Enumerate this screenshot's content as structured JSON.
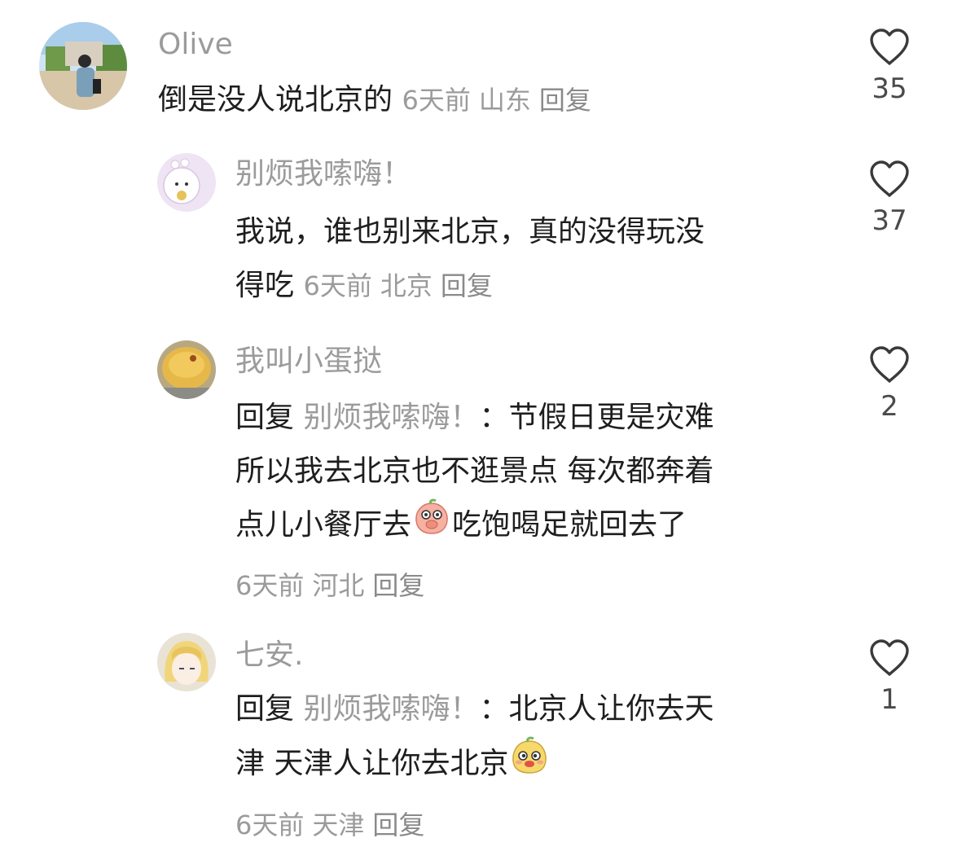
{
  "comments": [
    {
      "user": "Olive",
      "lines": [
        "倒是没人说北京的"
      ],
      "time": "6天前",
      "location": "山东",
      "reply": "回复",
      "likes": "35"
    },
    {
      "user": "别烦我嗦嗨！",
      "lines": [
        "我说，谁也别来北京，真的没得玩没",
        "得吃"
      ],
      "time": "6天前",
      "location": "北京",
      "reply": "回复",
      "likes": "37"
    },
    {
      "user": "我叫小蛋挞",
      "reply_prefix": "回复",
      "reply_target": "别烦我嗦嗨！",
      "lines": [
        "：节假日更是灾难",
        "所以我去北京也不逛景点 每次都奔着",
        "点儿小餐厅去",
        "吃饱喝足就回去了"
      ],
      "time": "6天前",
      "location": "河北",
      "reply": "回复",
      "likes": "2"
    },
    {
      "user": "七安.",
      "reply_prefix": "回复",
      "reply_target": "别烦我嗦嗨！",
      "lines": [
        "：北京人让你去天",
        "津 天津人让你去北京"
      ],
      "time": "6天前",
      "location": "天津",
      "reply": "回复",
      "likes": "1"
    }
  ],
  "icons": {
    "like": "heart-outline-icon",
    "emoji_1": "peach-covering-mouth-emoji",
    "emoji_2": "yellow-blob-smug-emoji"
  },
  "colors": {
    "username": "#9b9b9b",
    "meta": "#9b9b9b",
    "text": "#1e1e1e",
    "heart": "#3a3a3a"
  }
}
